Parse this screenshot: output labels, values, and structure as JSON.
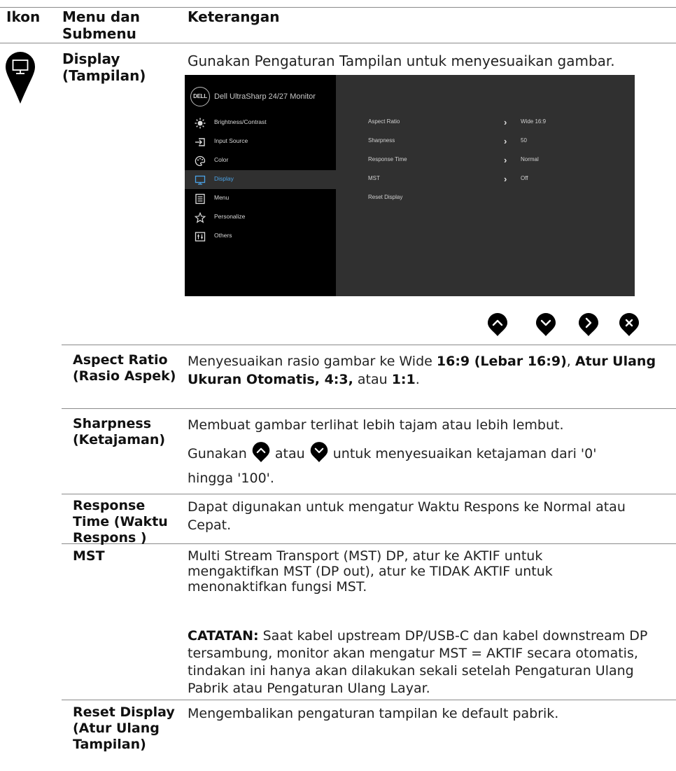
{
  "header": {
    "col_icon": "Ikon",
    "col_menu": "Menu dan Submenu",
    "col_desc": "Keterangan"
  },
  "display": {
    "title": "Display (Tampilan)",
    "intro": "Gunakan Pengaturan Tampilan untuk menyesuaikan gambar."
  },
  "osd": {
    "logo": "DELL",
    "title": "Dell UltraSharp 24/27 Monitor",
    "menu_items": [
      {
        "label": "Brightness/Contrast",
        "icon": "brightness-icon"
      },
      {
        "label": "Input Source",
        "icon": "input-source-icon"
      },
      {
        "label": "Color",
        "icon": "color-palette-icon"
      },
      {
        "label": "Display",
        "icon": "display-monitor-icon",
        "active": true
      },
      {
        "label": "Menu",
        "icon": "menu-icon"
      },
      {
        "label": "Personalize",
        "icon": "star-icon"
      },
      {
        "label": "Others",
        "icon": "others-icon"
      }
    ],
    "settings": [
      {
        "label": "Aspect Ratio",
        "value": "Wide 16:9"
      },
      {
        "label": "Sharpness",
        "value": "50"
      },
      {
        "label": "Response Time",
        "value": "Normal"
      },
      {
        "label": "MST",
        "value": "Off"
      },
      {
        "label": "Reset Display",
        "value": ""
      }
    ],
    "active_color": "#4aa3e8"
  },
  "nav_buttons": [
    "up-button",
    "down-button",
    "right-button",
    "close-button"
  ],
  "rows": {
    "aspect": {
      "name": "Aspect Ratio (Rasio Aspek)",
      "desc_1": "Menyesuaikan rasio gambar ke Wide ",
      "desc_b1": "16:9 (Lebar 16:9)",
      "desc_2": ", ",
      "desc_b2": "Atur Ulang Ukuran Otomatis, 4:3,",
      "desc_3": " atau ",
      "desc_b3": "1:1",
      "desc_4": "."
    },
    "sharpness": {
      "name": "Sharpness (Ketajaman)",
      "desc_1": "Membuat gambar terlihat lebih tajam atau lebih lembut.",
      "desc_2a": "Gunakan ",
      "desc_2b": " atau ",
      "desc_2c": " untuk menyesuaikan ketajaman dari '0'",
      "desc_3": "hingga '100'."
    },
    "response": {
      "name": "Response Time (Waktu Respons )",
      "desc": "Dapat digunakan untuk mengatur Waktu Respons ke Normal atau Cepat."
    },
    "mst": {
      "name": "MST",
      "desc": "Multi Stream Transport (MST) DP, atur ke AKTIF untuk mengaktifkan MST (DP out), atur ke TIDAK AKTIF untuk menonaktifkan fungsi MST.",
      "note_label": "CATATAN:",
      "note": " Saat kabel upstream DP/USB-C dan kabel downstream DP tersambung, monitor akan mengatur MST = AKTIF secara otomatis, tindakan ini hanya akan dilakukan sekali setelah Pengaturan Ulang Pabrik atau Pengaturan Ulang Layar."
    },
    "reset": {
      "name": "Reset Display (Atur Ulang Tampilan)",
      "desc": "Mengembalikan pengaturan tampilan ke default pabrik."
    }
  }
}
